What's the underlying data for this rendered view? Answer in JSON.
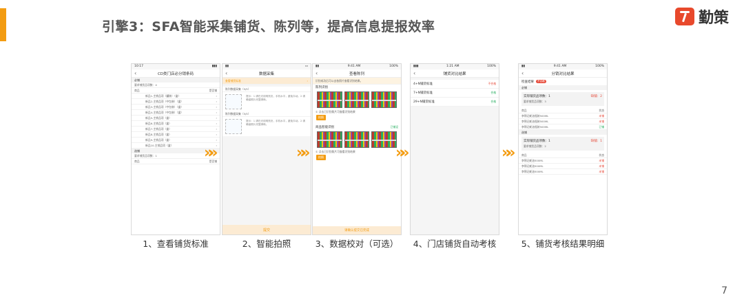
{
  "title": "引擎3：SFA智能采集铺货、陈列等，提高信息提报效率",
  "logo": {
    "text": "勤策",
    "icon": "qince-logo-icon"
  },
  "page_number": "7",
  "arrow_glyph": "»»",
  "colors": {
    "accent": "#f39c12",
    "logo": "#e8492c"
  },
  "steps": [
    {
      "caption": "1、查看铺货标准",
      "status_time": "10:17",
      "nav_title": "CD类门店必分销条码",
      "sections": [
        {
          "label": "必铺",
          "note": "要求铺货品项数：4",
          "columns": [
            "商品",
            "是否铺"
          ],
          "items": [
            "新品1-主销品项（罐装）（盒）",
            "新品2-主销品项（中包装）（盒）",
            "新品3-主销品项（中包装）（盒）",
            "新品4-主销品项（中包装）（盒）",
            "新品5-主销品项（盒）",
            "新品6-主销品项（盒）",
            "新品7-主销品项（盒）",
            "新品8-主销品项（盒）",
            "新品9-主销品项（盒）",
            "新品10-主销品项（盒）"
          ]
        },
        {
          "label": "选铺",
          "note": "要求铺货品项数：1",
          "columns": [
            "商品",
            "是否铺"
          ]
        }
      ]
    },
    {
      "caption": "2、智能拍照",
      "nav_title": "数据采集",
      "highlight": "查看铺货标准",
      "blocks": [
        {
          "title": "陈列数据采集（5/5）",
          "hint": "提示：1.请在光线明亮处，手机水平，避免抖动。2.请确保照片完整清晰。"
        },
        {
          "title": "陈列数据采集（5/5）",
          "hint": "提示：1.请在光线明亮处，手机水平，避免抖动。2.请确保照片完整清晰。"
        }
      ],
      "submit": "提交"
    },
    {
      "caption": "3、数据校对（可选）",
      "status_time": "9:41 AM",
      "battery": "100%",
      "nav_title": "查看陈列",
      "notice": "识别成功后可以去各照片查看识别结果。",
      "groups": [
        {
          "title": "陈列识别",
          "tag": "",
          "note": "①  点击已识别照片可查看识别结果",
          "button": "拍照"
        },
        {
          "title": "商品智能识别",
          "tag": "已铺设",
          "note": "①  点击已识别照片可查看识别结果",
          "button": "拍照"
        }
      ],
      "footer": "请确认提交已完成"
    },
    {
      "caption": "4、门店铺货自动考核",
      "status_time": "1:21 AM",
      "battery": "100%",
      "nav_title": "铺货对比结果",
      "rows": [
        {
          "label": "4+N铺货标准",
          "status": "不合格",
          "tone": "red"
        },
        {
          "label": "7+N铺货标准",
          "status": "合格",
          "tone": "green"
        },
        {
          "label": "29+N铺货标准",
          "status": "合格",
          "tone": "green"
        }
      ]
    },
    {
      "caption": "5、铺货考核结果明细",
      "status_time": "9:41 AM",
      "battery": "100%",
      "nav_title": "分销对比结果",
      "check_label": "检查结果",
      "check_badge": "不合格",
      "sections": [
        {
          "label": "必铺",
          "actual": "实际铺货品项数：1",
          "required": "要求铺货品项数：3",
          "missing": "缺铺：2",
          "columns": [
            "商品",
            "状态"
          ],
          "items": [
            {
              "name": "李锦记蚝油瓶装500ML",
              "status": "未铺",
              "tone": "red"
            },
            {
              "name": "李锦记蚝油瓶装500ML",
              "status": "未铺",
              "tone": "red"
            },
            {
              "name": "李锦记蚝油瓶装500ML",
              "status": "已铺",
              "tone": "green"
            }
          ]
        },
        {
          "label": "选铺",
          "actual": "实际铺货品项数：1",
          "required": "要求铺货品项数：2",
          "missing": "缺铺：1",
          "columns": [
            "商品",
            "状态"
          ],
          "items": [
            {
              "name": "李锦记蚝油500ML",
              "status": "未铺",
              "tone": "red"
            },
            {
              "name": "李锦记蚝油500ML",
              "status": "未铺",
              "tone": "red"
            },
            {
              "name": "李锦记蚝油500ML",
              "status": "未铺",
              "tone": "red"
            }
          ]
        }
      ]
    }
  ]
}
